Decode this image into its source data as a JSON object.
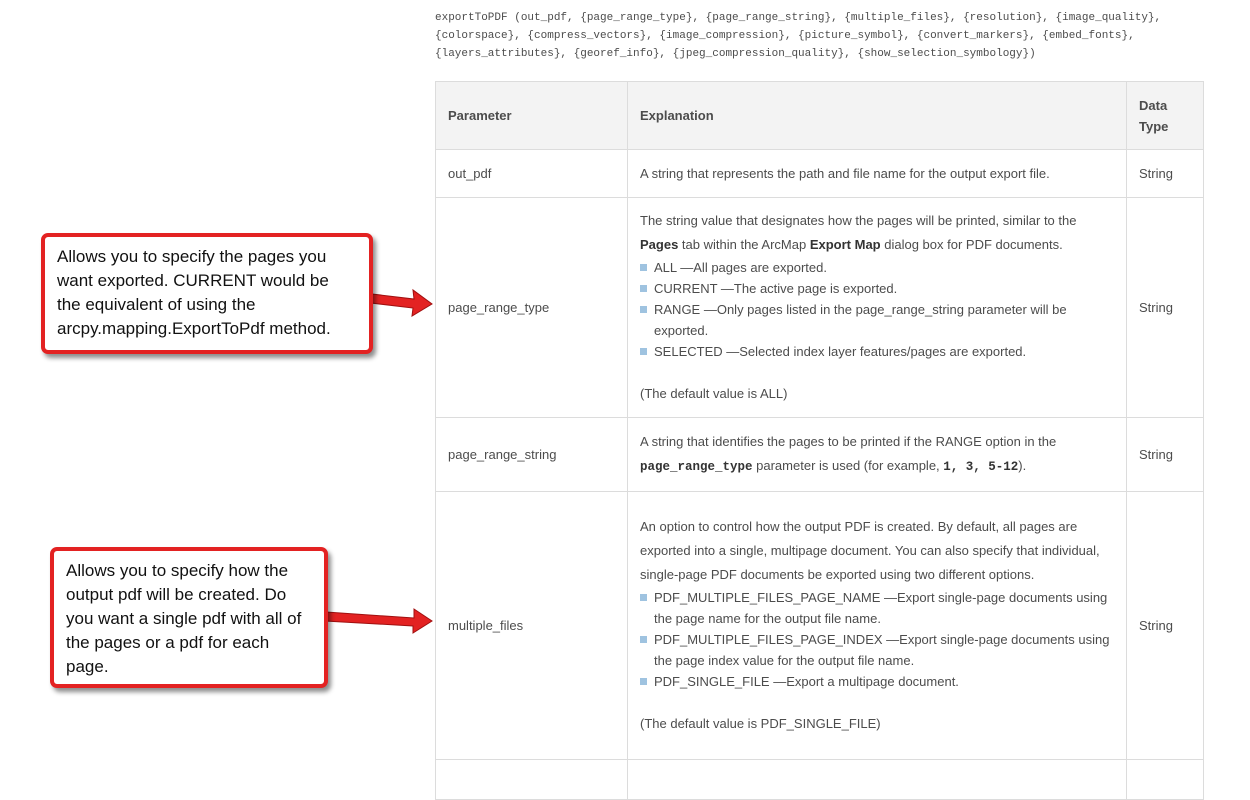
{
  "signature": {
    "lines": [
      "exportToPDF (out_pdf, {page_range_type}, {page_range_string}, {multiple_files}, {resolution}, {image_quality},",
      "{colorspace}, {compress_vectors}, {image_compression}, {picture_symbol}, {convert_markers}, {embed_fonts},",
      "{layers_attributes}, {georef_info}, {jpeg_compression_quality}, {show_selection_symbology})"
    ]
  },
  "table": {
    "headers": {
      "parameter": "Parameter",
      "explanation": "Explanation",
      "data_type_line1": "Data",
      "data_type_line2": "Type"
    },
    "rows": [
      {
        "param": "out_pdf",
        "text": "A string that represents the path and file name for the output export file.",
        "type": "String"
      },
      {
        "param": "page_range_type",
        "intro_pre": "The string value that designates how the pages will be printed, similar to the ",
        "intro_bold1": "Pages",
        "intro_mid": " tab within the ArcMap ",
        "intro_bold2": "Export Map",
        "intro_post": " dialog box for PDF documents.",
        "bullets": [
          "ALL —All pages are exported.",
          "CURRENT —The active page is exported.",
          "RANGE —Only pages listed in the page_range_string parameter will be exported.",
          "SELECTED —Selected index layer features/pages are exported."
        ],
        "default": "(The default value is ALL)",
        "type": "String"
      },
      {
        "param": "page_range_string",
        "pre": "A string that identifies the pages to be printed if the RANGE option in the ",
        "code1": "page_range_type",
        "mid": " parameter is used (for example, ",
        "code2": "1, 3, 5-12",
        "post": ").",
        "type": "String"
      },
      {
        "param": "multiple_files",
        "intro": "An option to control how the output PDF is created. By default, all pages are exported into a single, multipage document. You can also specify that individual, single-page PDF documents be exported using two different options.",
        "bullets": [
          "PDF_MULTIPLE_FILES_PAGE_NAME —Export single-page documents using the page name for the output file name.",
          "PDF_MULTIPLE_FILES_PAGE_INDEX —Export single-page documents using the page index value for the output file name.",
          "PDF_SINGLE_FILE —Export a multipage document."
        ],
        "default": "(The default value is PDF_SINGLE_FILE)",
        "type": "String"
      }
    ]
  },
  "callouts": [
    {
      "text": "Allows you to specify the pages you want exported. CURRENT would be the equivalent of using the arcpy.mapping.ExportToPdf method."
    },
    {
      "text": "Allows you to specify how the output pdf will be created. Do you want a single pdf with all of the pages or a pdf for each page."
    }
  ],
  "colors": {
    "callout_border": "#e32222",
    "arrow": "#e32222",
    "bullet": "#9fc3e0",
    "header_bg": "#f3f3f3"
  }
}
